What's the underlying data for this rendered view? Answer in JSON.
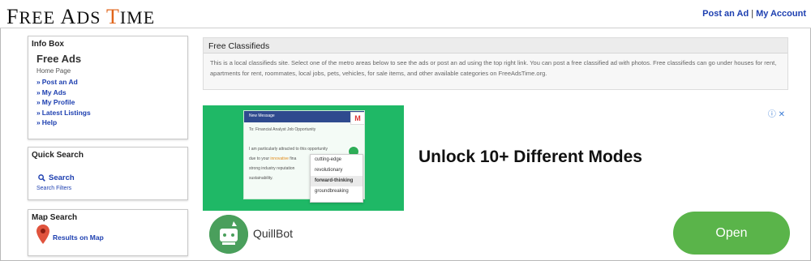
{
  "header": {
    "logo": {
      "f": "F",
      "ree": "REE",
      "a": "A",
      "ds": "DS",
      "t": "T",
      "ime": "IME"
    },
    "links": {
      "post_ad": "Post an Ad",
      "separator": "|",
      "my_account": "My Account"
    }
  },
  "info_box": {
    "title": "Info Box",
    "site_name": "Free Ads",
    "home_page": "Home Page",
    "bullet": "»",
    "links": [
      "Post an Ad",
      "My Ads",
      "My Profile",
      "Latest Listings",
      "Help"
    ]
  },
  "quick_search": {
    "title": "Quick Search",
    "search_label": "Search",
    "filters_label": "Search Filters"
  },
  "map_search": {
    "title": "Map Search",
    "results_label": "Results on Map"
  },
  "free_classifieds": {
    "title": "Free Classifieds",
    "description": "This is a local classifieds site. Select one of the metro areas below to see the ads or post an ad using the top right link. You can post a free classified ad with photos. Free classifieds can go under houses for rent, apartments for rent, roommates, local jobs, pets, vehicles, for sale items, and other available categories on FreeAdsTime.org."
  },
  "ad": {
    "headline": "Unlock 10+ Different Modes",
    "brand": "QuillBot",
    "cta": "Open",
    "mock": {
      "window_title": "New Message",
      "to_line": "To: Financial Analyst Job Opportunity",
      "body_line1": "I am particularly attracted to this opportunity",
      "body_line2_pre": "due to your ",
      "body_line2_hl": "innovative",
      "body_line2_post": " fina",
      "body_line3": "strong industry reputation",
      "body_line4": "sustainability.",
      "gmail": "M",
      "options": [
        "cutting-edge",
        "revolutionary",
        "forward-thinking",
        "groundbreaking"
      ]
    },
    "colors": {
      "green": "#1fb866",
      "button": "#5ab44a",
      "link": "#1d3fb0",
      "accent": "#e0651b"
    }
  }
}
